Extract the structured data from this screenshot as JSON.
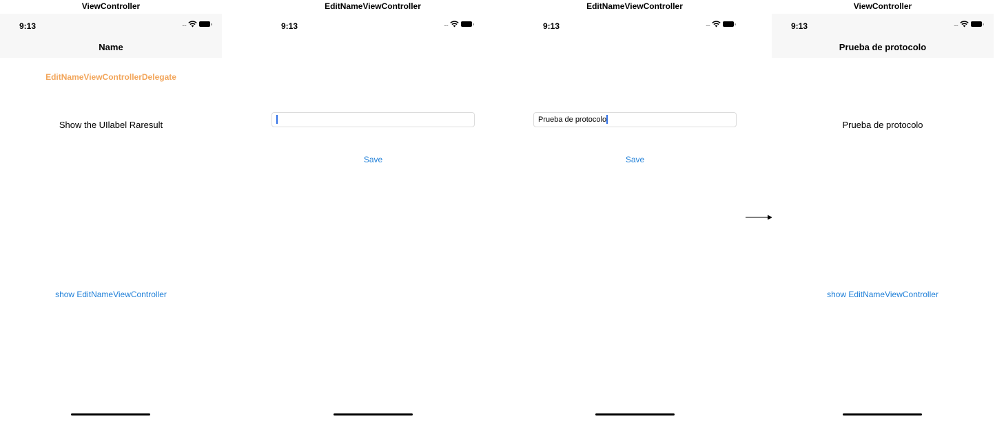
{
  "status_time": "9:13",
  "panels": [
    {
      "controller": "ViewController",
      "nav_title": "Name",
      "delegate_label": "EditNameViewControllerDelegate",
      "result_label": "Show the UIlabel Raresult",
      "show_link": "show EditNameViewController"
    },
    {
      "controller": "EditNameViewController",
      "field_value": "",
      "save_label": "Save"
    },
    {
      "controller": "EditNameViewController",
      "field_value": "Prueba de protocolo",
      "save_label": "Save"
    },
    {
      "controller": "ViewController",
      "nav_title": "Prueba de protocolo",
      "result_label": "Prueba de protocolo",
      "show_link": "show EditNameViewController"
    }
  ],
  "colors": {
    "link": "#1e7fd8",
    "delegate_label": "#f2a55a",
    "caret": "#2f6fe6",
    "navbar": "#f7f7f7"
  }
}
